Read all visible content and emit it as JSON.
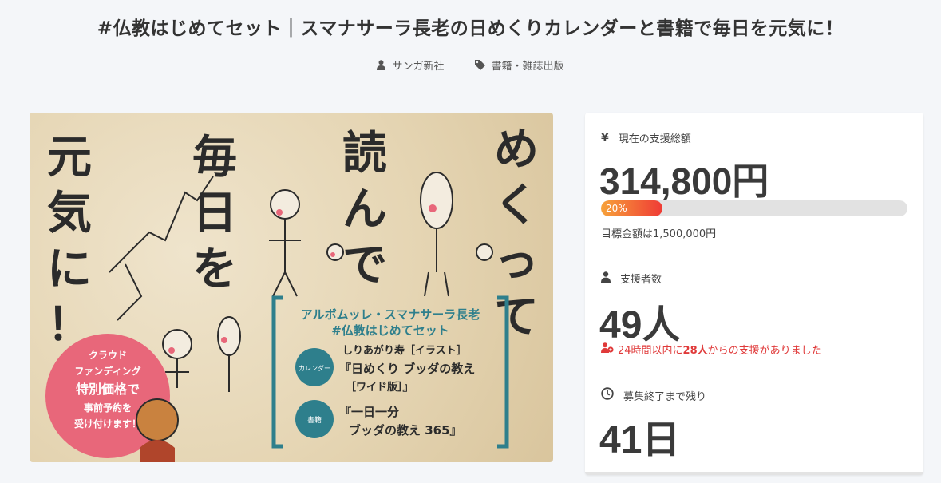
{
  "project": {
    "title": "#仏教はじめてセット｜スマナサーラ長老の日めくりカレンダーと書籍で毎日を元気に！",
    "owner": "サンガ新社",
    "category": "書籍・雑誌出版"
  },
  "hero": {
    "headline_col1": [
      "元",
      "気",
      "に",
      "！"
    ],
    "headline_col2": [
      "毎",
      "日",
      "を"
    ],
    "headline_col3": [
      "読",
      "ん",
      "で"
    ],
    "headline_col4": [
      "め",
      "く",
      "っ",
      "て"
    ],
    "box_title_1": "アルボムッレ・スマナサーラ長老",
    "box_title_2": "#仏教はじめてセット",
    "badge_calendar": "カレンダー",
    "badge_book": "書籍",
    "item1_line1": "しりあがり寿［イラスト］",
    "item1_line2": "『日めくり ブッダの教え",
    "item1_line3": "［ワイド版］』",
    "item2_line1": "『一日一分",
    "item2_line2": "ブッダの教え 365』",
    "circle_lines": [
      "クラウド",
      "ファンディング",
      "特別価格で",
      "事前予約を",
      "受け付けます！"
    ],
    "colors": {
      "teal": "#2e7f8c",
      "pink": "#e8677a",
      "ink": "#2b2b2b"
    }
  },
  "funding": {
    "total_label": "現在の支援総額",
    "total_value": "314,800円",
    "progress_percent": 20,
    "progress_label": "20%",
    "goal_text": "目標金額は1,500,000円",
    "supporters_label": "支援者数",
    "supporters_value": "49人",
    "recent_prefix": "24時間以内に",
    "recent_count": "28人",
    "recent_suffix": "からの支援がありました",
    "remaining_label": "募集終了まで残り",
    "remaining_value": "41日"
  },
  "icons": {
    "owner": "user-icon",
    "category": "tag-icon",
    "total": "yen-icon",
    "supporters": "user-icon",
    "recent": "user-plus-icon",
    "remaining": "clock-icon"
  }
}
